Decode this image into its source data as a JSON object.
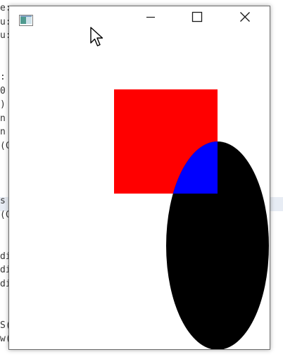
{
  "window": {
    "title": "",
    "controls": {
      "minimize": "minimize",
      "maximize": "maximize",
      "close": "close"
    }
  },
  "canvas": {
    "background": "#ffffff",
    "shapes": [
      {
        "kind": "rectangle",
        "fill": "#ff0000"
      },
      {
        "kind": "ellipse",
        "fill": "#000000"
      },
      {
        "kind": "intersection",
        "fill": "#0000ff"
      }
    ]
  },
  "background_editor": {
    "lines": [
      "e:",
      "u:",
      "u:",
      "",
      "",
      ":",
      "0",
      ")",
      "n",
      "n",
      "(C",
      "",
      "",
      "",
      "s",
      "(C",
      "",
      "",
      "di",
      "di",
      "di",
      "",
      "",
      "S(",
      "w("
    ]
  },
  "colors": {
    "rectangle": "#ff0000",
    "ellipse": "#000000",
    "overlap": "#0000ff",
    "window_border": "#6b6b6b"
  }
}
